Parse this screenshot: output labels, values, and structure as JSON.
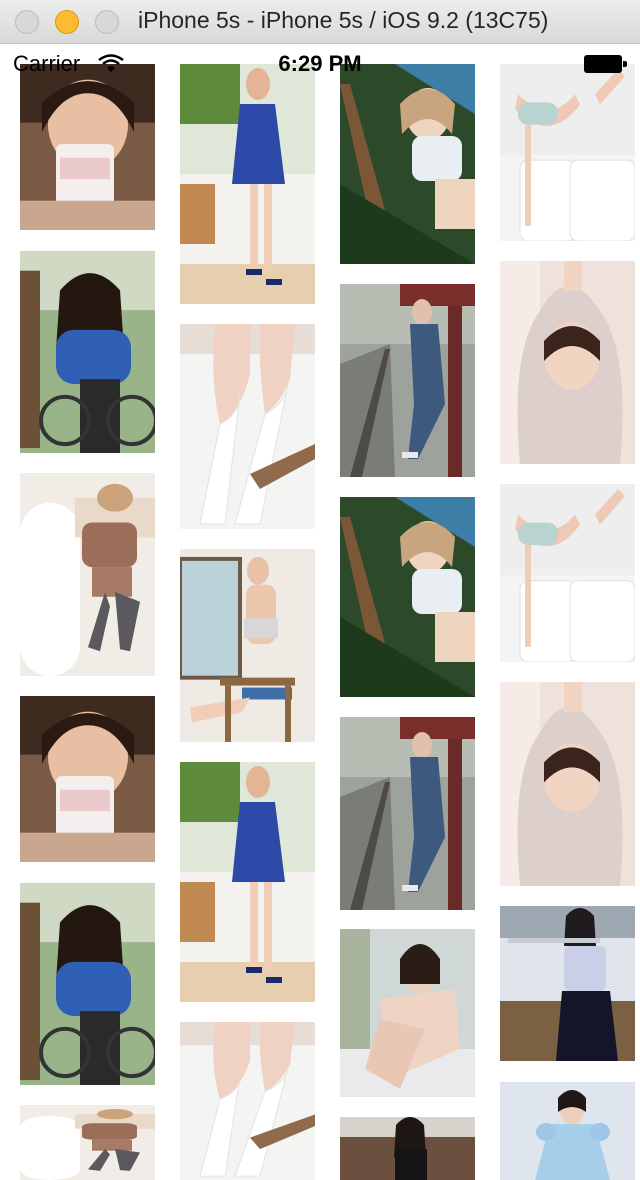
{
  "window": {
    "title": "iPhone 5s - iPhone 5s / iOS 9.2 (13C75)"
  },
  "status_bar": {
    "carrier": "Carrier",
    "time": "6:29 PM"
  },
  "photos": {
    "p1": {
      "icon": "photo-girl-drinking-cup"
    },
    "p2": {
      "icon": "photo-girl-blue-jacket-bicycle"
    },
    "p3": {
      "icon": "photo-girl-lying-on-sofa"
    },
    "p4": {
      "icon": "photo-girl-blue-dress-room"
    },
    "p5": {
      "icon": "photo-legs-white-stockings"
    },
    "p6": {
      "icon": "photo-girl-by-window-chair"
    },
    "p7": {
      "icon": "photo-girl-leaning-railing"
    },
    "p8": {
      "icon": "photo-girl-train-platform"
    },
    "p9": {
      "icon": "photo-girl-sitting-knees"
    },
    "p10": {
      "icon": "photo-girl-dark-dress"
    },
    "p11": {
      "icon": "photo-legs-on-white-bed"
    },
    "p12": {
      "icon": "photo-girl-pink-hoodie"
    },
    "p13": {
      "icon": "photo-girl-playing-flute"
    },
    "p14": {
      "icon": "photo-girl-light-blue-dress"
    }
  }
}
